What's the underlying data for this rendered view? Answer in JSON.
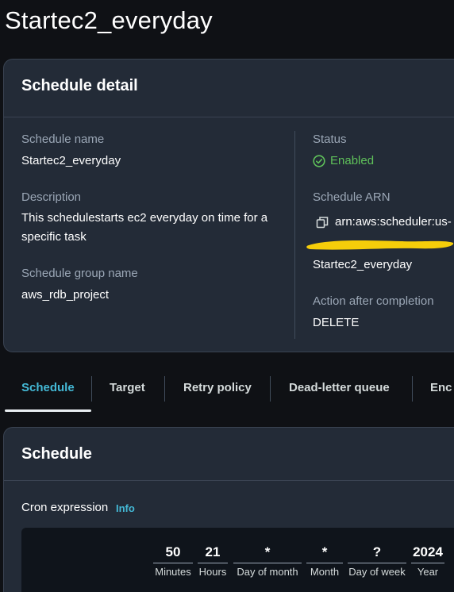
{
  "page": {
    "title": "Startec2_everyday"
  },
  "detail": {
    "title": "Schedule detail",
    "schedule_name_label": "Schedule name",
    "schedule_name_value": "Startec2_everyday",
    "description_label": "Description",
    "description_value": "This schedulestarts ec2 everyday on time for a specific task",
    "group_label": "Schedule group name",
    "group_value": "aws_rdb_project",
    "status_label": "Status",
    "status_value": "Enabled",
    "arn_label": "Schedule ARN",
    "arn_value": "arn:aws:scheduler:us-",
    "arn_tail": "Startec2_everyday",
    "action_label": "Action after completion",
    "action_value": "DELETE",
    "status_color": "#5fc15a",
    "redaction_color": "#f5cd0a"
  },
  "tabs": [
    {
      "label": "Schedule",
      "active": true
    },
    {
      "label": "Target",
      "active": false
    },
    {
      "label": "Retry policy",
      "active": false
    },
    {
      "label": "Dead-letter queue",
      "active": false
    },
    {
      "label": "Enc",
      "active": false
    }
  ],
  "schedule": {
    "title": "Schedule",
    "cron_label": "Cron expression",
    "info_link": "Info",
    "fields": [
      {
        "value": "50",
        "caption": "Minutes"
      },
      {
        "value": "21",
        "caption": "Hours"
      },
      {
        "value": "*",
        "caption": "Day of month"
      },
      {
        "value": "*",
        "caption": "Month"
      },
      {
        "value": "?",
        "caption": "Day of week"
      },
      {
        "value": "2024",
        "caption": "Year"
      }
    ]
  },
  "colors": {
    "accent": "#44b9d6",
    "panel_bg": "#232b37",
    "page_bg": "#0f1115"
  }
}
